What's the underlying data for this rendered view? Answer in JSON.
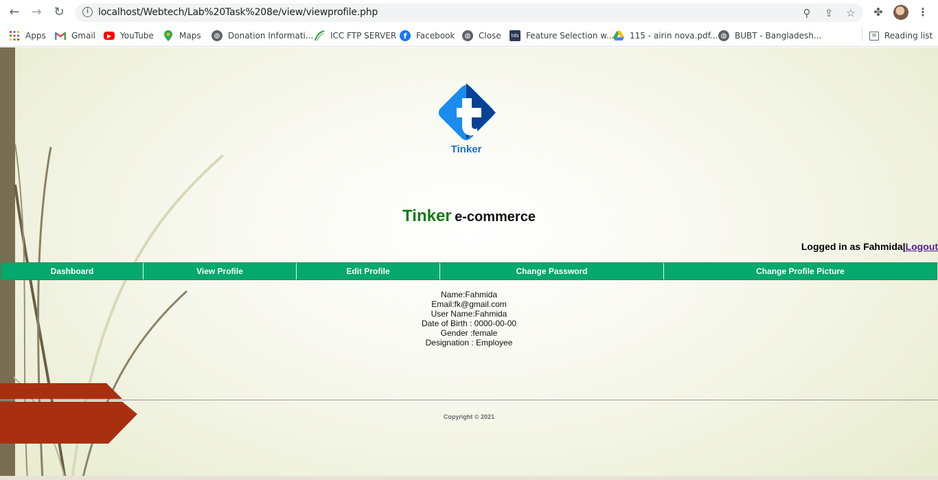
{
  "browser": {
    "url": "localhost/Webtech/Lab%20Task%208e/view/viewprofile.php",
    "bookmarks": [
      {
        "label": "Apps",
        "icon": "apps-grid-icon"
      },
      {
        "label": "Gmail",
        "icon": "gmail-icon"
      },
      {
        "label": "YouTube",
        "icon": "youtube-icon"
      },
      {
        "label": "Maps",
        "icon": "maps-pin-icon"
      },
      {
        "label": "Donation Informati...",
        "icon": "globe-icon"
      },
      {
        "label": "ICC FTP SERVER",
        "icon": "icc-leaf-icon"
      },
      {
        "label": "Facebook",
        "icon": "facebook-icon"
      },
      {
        "label": "Close",
        "icon": "globe-icon"
      },
      {
        "label": "Feature Selection w...",
        "icon": "tds-icon"
      },
      {
        "label": "115 - airin nova.pdf...",
        "icon": "google-drive-icon"
      },
      {
        "label": "BUBT - Bangladesh...",
        "icon": "globe-icon"
      }
    ],
    "reading_list": "Reading list",
    "tds_badge": "tds"
  },
  "page": {
    "logo_text": "Tinker",
    "brand": "Tinker",
    "tagline": "e-commerce",
    "logged_in_prefix": "Logged in as Fahmida|",
    "logout_label": "Logout",
    "menu": [
      {
        "label": "Dashboard"
      },
      {
        "label": "View Profile"
      },
      {
        "label": "Edit Profile"
      },
      {
        "label": "Change Password"
      },
      {
        "label": "Change Profile Picture"
      }
    ],
    "profile": {
      "name": "Name:Fahmida",
      "email": "Email:fk@gmail.com",
      "username": "User Name:Fahmida",
      "dob": "Date of Birth : 0000-00-00",
      "gender": "Gender :female",
      "designation": "Designation : Employee"
    },
    "copyright": "Copyright © 2021"
  },
  "colors": {
    "menu_bg": "#05a86d",
    "brand_green": "#127d12",
    "logo_blue": "#1a8cf0",
    "logo_navy": "#0a3d8f",
    "deco_red": "#a83010",
    "link_purple": "#551a8b"
  }
}
